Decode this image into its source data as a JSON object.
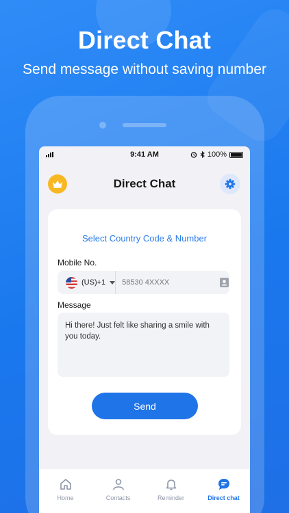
{
  "hero": {
    "title": "Direct Chat",
    "subtitle": "Send message without saving number"
  },
  "status_bar": {
    "time": "9:41 AM",
    "battery": "100%"
  },
  "header": {
    "title": "Direct Chat",
    "left_icon": "crown-icon",
    "right_icon": "gear-icon"
  },
  "form": {
    "heading": "Select Country Code & Number",
    "mobile_label": "Mobile No.",
    "country_code": "(US)+1",
    "number_value": "58530 4XXXX",
    "message_label": "Message",
    "message_value": "Hi there! Just felt like sharing a smile with you today.",
    "send_label": "Send"
  },
  "bottom_nav": {
    "items": [
      {
        "label": "Home",
        "icon": "home-icon"
      },
      {
        "label": "Contacts",
        "icon": "user-icon"
      },
      {
        "label": "Reminder",
        "icon": "bell-icon"
      },
      {
        "label": "Direct chat",
        "icon": "chat-icon",
        "active": true
      }
    ]
  },
  "colors": {
    "accent": "#1f74e8",
    "background": "#1a78ee",
    "premium": "#f8b824"
  }
}
